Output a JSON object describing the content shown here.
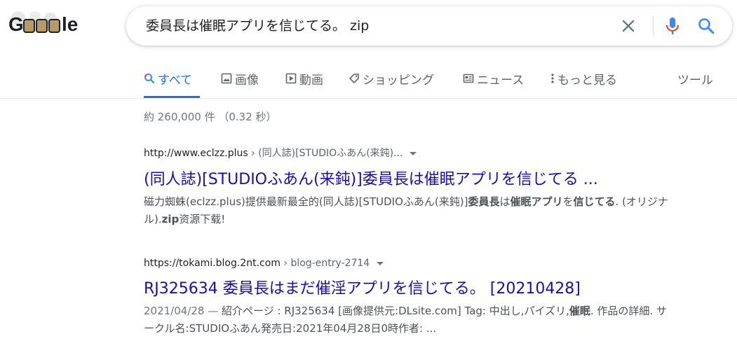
{
  "logo": {
    "text": "Google"
  },
  "search": {
    "query": "委員長は催眠アプリを信じてる。 zip"
  },
  "icons": {
    "clear": "close-icon",
    "mic": "microphone-icon",
    "search": "search-icon"
  },
  "tabs": [
    {
      "label": "すべて",
      "icon": "search-icon",
      "active": true
    },
    {
      "label": "画像",
      "icon": "image-icon"
    },
    {
      "label": "動画",
      "icon": "video-icon"
    },
    {
      "label": "ショッピング",
      "icon": "tag-icon"
    },
    {
      "label": "ニュース",
      "icon": "news-icon"
    },
    {
      "label": "もっと見る",
      "icon": "more-vert-icon"
    },
    {
      "label": "ツール"
    }
  ],
  "stats": "約 260,000 件 （0.32 秒）",
  "results": [
    {
      "url": "http://www.eclzz.plus",
      "crumb": " › (同人誌)[STUDIOふあん(来鈍)...",
      "title": "(同人誌)[STUDIOふあん(来鈍)]委員長は催眠アプリを信じてる ...",
      "snippet": [
        {
          "t": "磁力蜘蛛(eclzz.plus)提供最新最全的(同人誌)[STUDIOふあん(来鈍)]"
        },
        {
          "t": "委員長",
          "b": true
        },
        {
          "t": "は"
        },
        {
          "t": "催眠アプリ",
          "b": true
        },
        {
          "t": "を"
        },
        {
          "t": "信じてる",
          "b": true
        },
        {
          "t": ". (オリジナル)."
        },
        {
          "t": "zip",
          "b": true
        },
        {
          "t": "资源下载!"
        }
      ]
    },
    {
      "url": "https://tokami.blog.2nt.com",
      "crumb": " › blog-entry-2714",
      "title": "RJ325634 委員長はまだ催淫アプリを信じてる。 [20210428]",
      "date": "2021/04/28 — ",
      "snippet": [
        {
          "t": "紹介ページ : RJ325634 [画像提供元:DLsite.com] Tag: 中出し,パイズリ,"
        },
        {
          "t": "催眠",
          "b": true
        },
        {
          "t": ". 作品の詳細. サークル名:STUDIOふあん発売日:2021年04月28日0時作者: ..."
        }
      ]
    }
  ]
}
